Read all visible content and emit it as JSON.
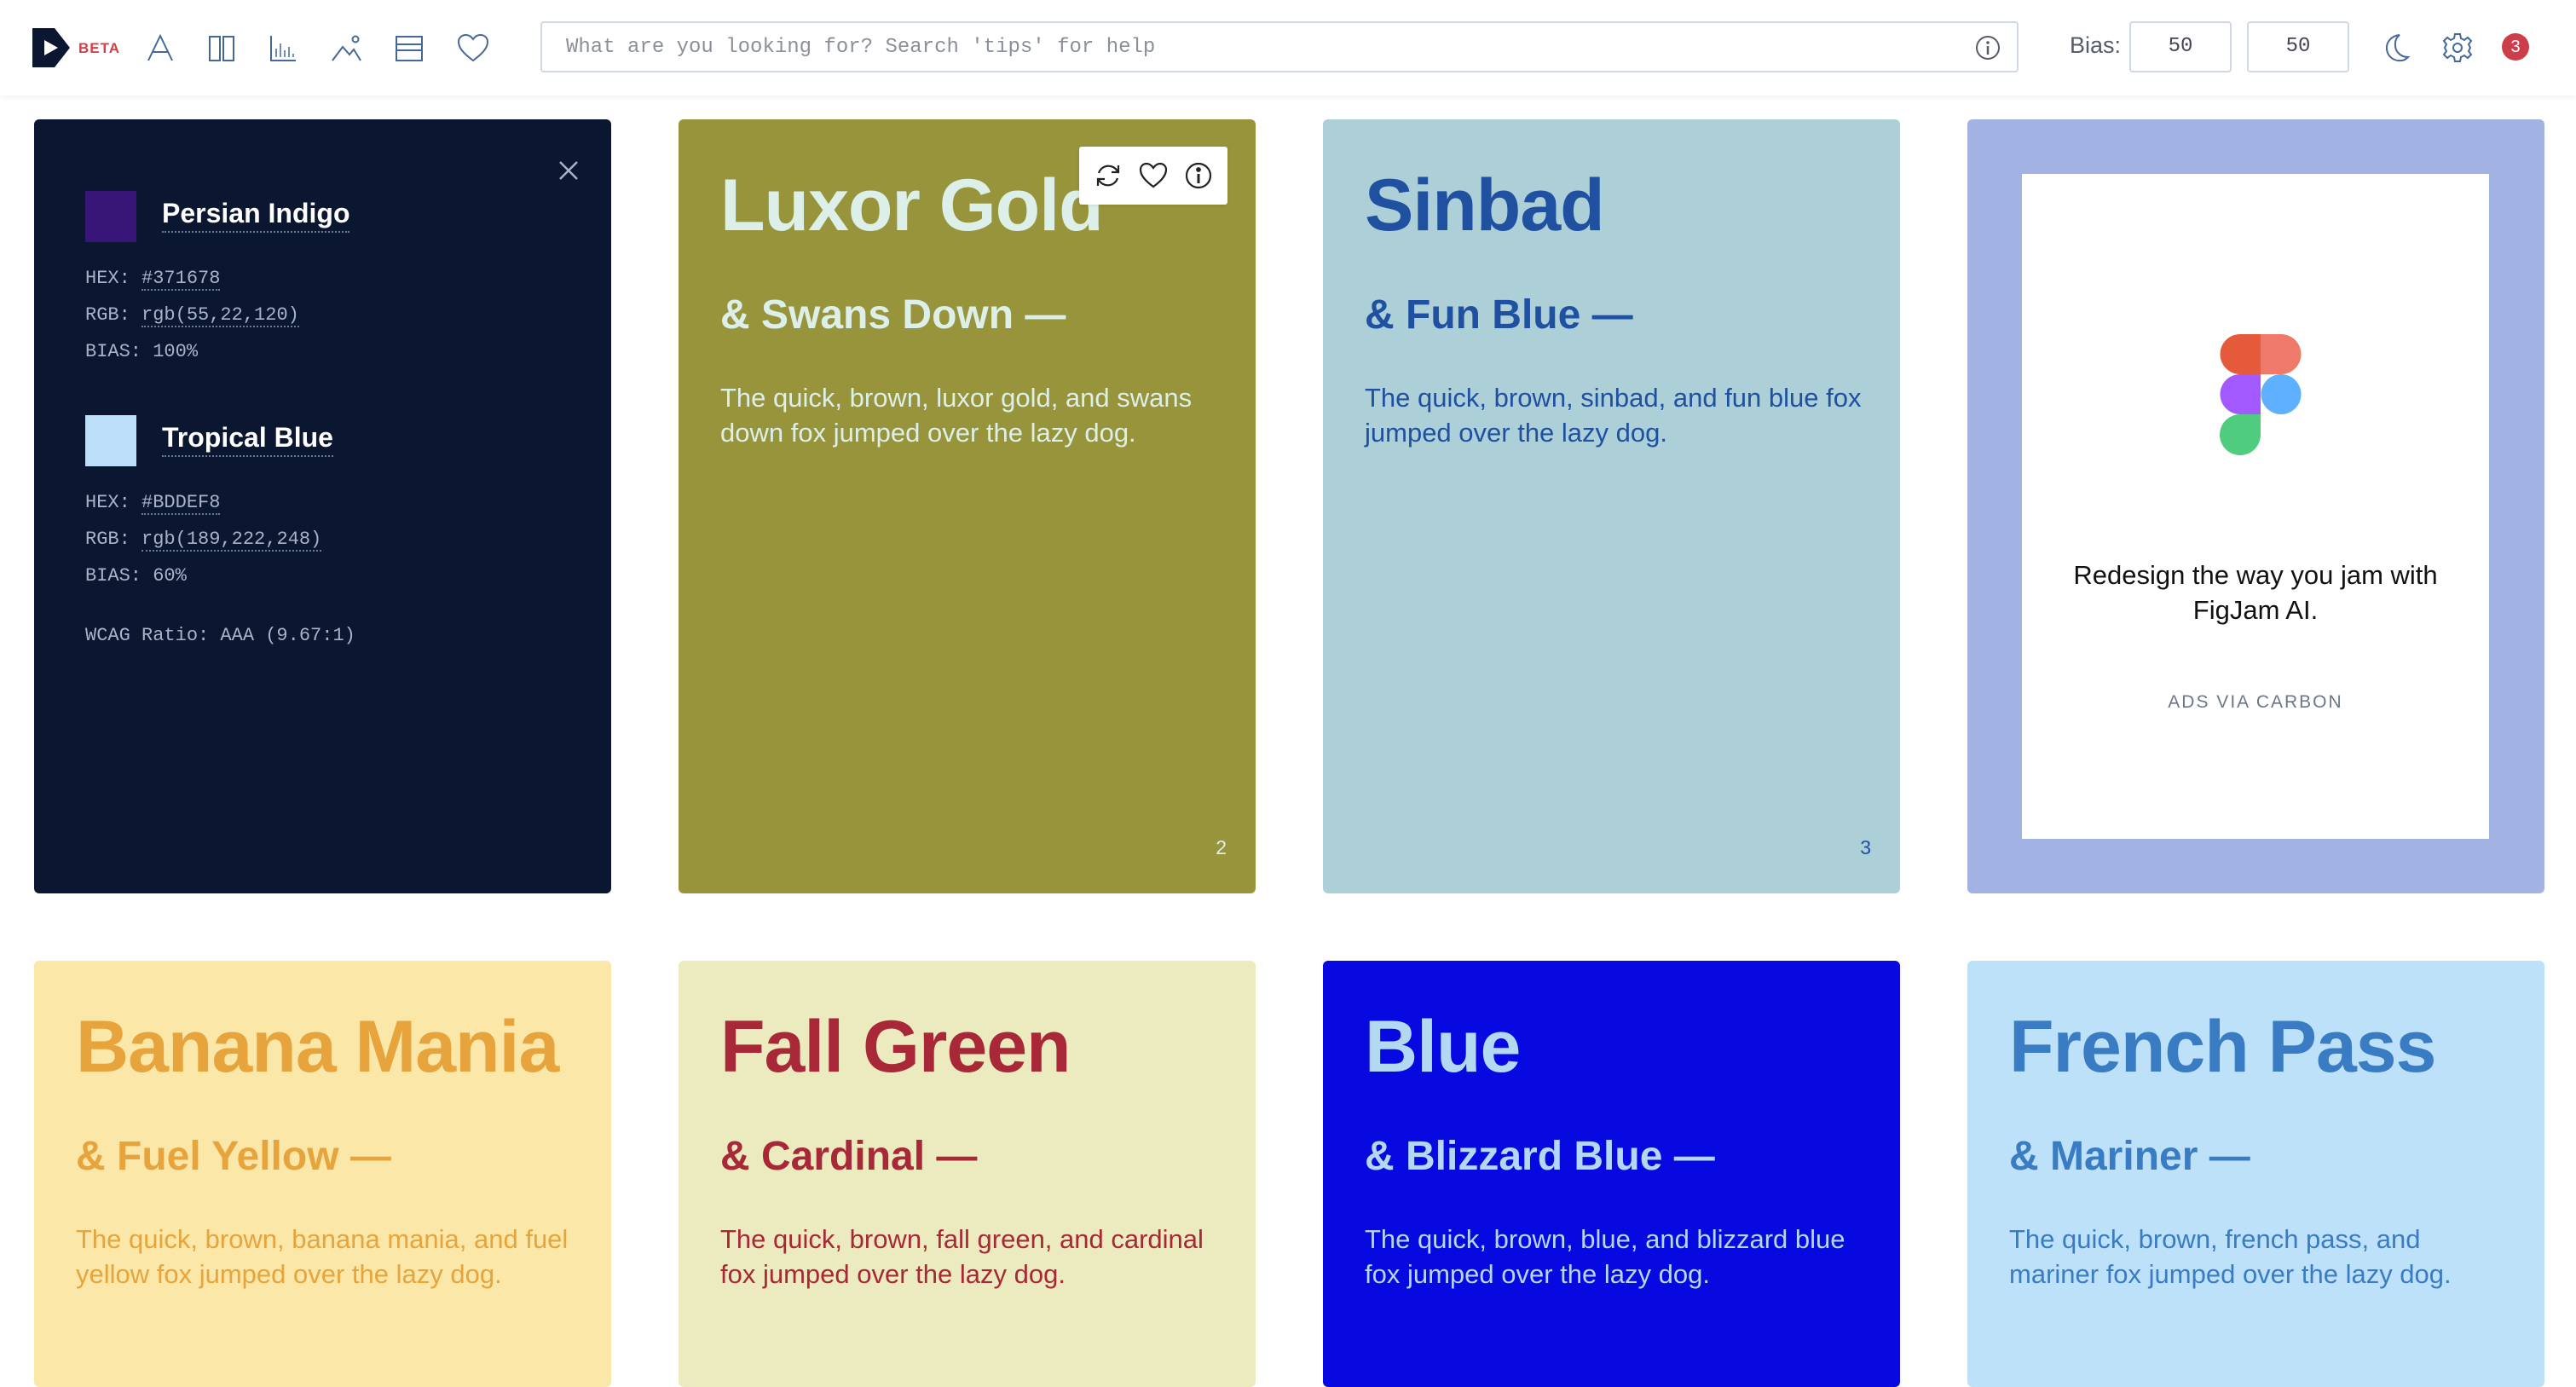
{
  "header": {
    "beta_label": "BETA",
    "search_placeholder": "What are you looking for? Search 'tips' for help",
    "bias_label": "Bias:",
    "bias_value_1": "50",
    "bias_value_2": "50",
    "notification_count": "3",
    "nav_icons": [
      "typography-icon",
      "columns-icon",
      "chart-icon",
      "image-icon",
      "rows-icon",
      "heart-icon"
    ]
  },
  "info_card": {
    "color_1": {
      "name": "Persian Indigo",
      "hex_label": "HEX:",
      "hex": "#371678",
      "rgb_label": "RGB:",
      "rgb": "rgb(55,22,120)",
      "bias": "BIAS: 100%",
      "swatch": "#371678"
    },
    "color_2": {
      "name": "Tropical Blue",
      "hex_label": "HEX:",
      "hex": "#BDDEF8",
      "rgb_label": "RGB:",
      "rgb": "rgb(189,222,248)",
      "bias": "BIAS: 60%",
      "swatch": "#BDDEF8"
    },
    "wcag": "WCAG Ratio: AAA (9.67:1)"
  },
  "cards": [
    {
      "title": "Luxor Gold",
      "subtitle": "& Swans Down —",
      "desc": "The quick, brown, luxor gold, and swans down fox jumped over the lazy dog.",
      "number": "2",
      "bg": "#98943c",
      "fg": "#dcefe8"
    },
    {
      "title": "Sinbad",
      "subtitle": "& Fun Blue —",
      "desc": "The quick, brown, sinbad, and fun blue fox jumped over the lazy dog.",
      "number": "3",
      "bg": "#accfd8",
      "fg": "#2050a0"
    },
    {
      "title": "Banana Mania",
      "subtitle": "& Fuel Yellow —",
      "desc": "The quick, brown, banana mania, and fuel yellow fox jumped over the lazy dog.",
      "number": "",
      "bg": "#fbe7a8",
      "fg": "#e8a43c"
    },
    {
      "title": "Fall Green",
      "subtitle": "& Cardinal —",
      "desc": "The quick, brown, fall green, and cardinal fox jumped over the lazy dog.",
      "number": "",
      "bg": "#ecebbf",
      "fg": "#a82838"
    },
    {
      "title": "Blue",
      "subtitle": "& Blizzard Blue —",
      "desc": "The quick, brown, blue, and blizzard blue fox jumped over the lazy dog.",
      "number": "",
      "bg": "#0808e0",
      "fg": "#b2d8f2"
    },
    {
      "title": "French Pass",
      "subtitle": "& Mariner —",
      "desc": "The quick, brown, french pass, and mariner fox jumped over the lazy dog.",
      "number": "",
      "bg": "#bde1f8",
      "fg": "#3a7cc4"
    }
  ],
  "ad": {
    "text": "Redesign the way you jam with FigJam AI.",
    "via": "ADS VIA CARBON"
  }
}
